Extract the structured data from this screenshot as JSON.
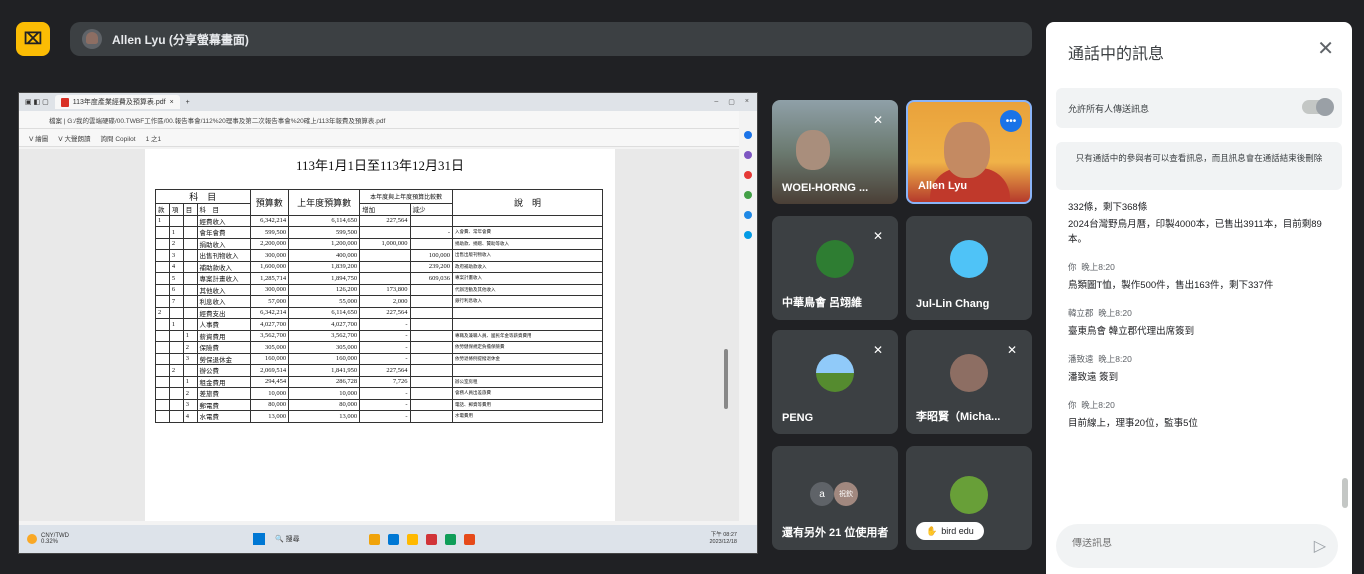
{
  "presenter": {
    "label": "Allen Lyu (分享螢幕畫面)"
  },
  "screen": {
    "tab_title": "113年度產業經費及預算表.pdf",
    "address": "檔案 | G:/我的雲端硬碟/00.TWBF工作區/00.報告事會/112%20理事及第二次報告事會%20確上/113年報費及預算表.pdf",
    "toolbar_items": [
      "Ⅴ 繪圖",
      "Ⅴ 大聲朗讀",
      "詢問 Copilot",
      "1 之1"
    ],
    "doc_title": "113年1月1日至113年12月31日",
    "table": {
      "headers": {
        "subject": "科　目",
        "budget": "預算數",
        "prev": "上年度預算數",
        "compare": "本年度與上年度預算比較數",
        "inc": "增加",
        "dec": "減少",
        "note": "說　明"
      },
      "sub_headers": [
        "款",
        "項",
        "目",
        "科　目"
      ],
      "rows": [
        {
          "k": "1",
          "x": "",
          "m": "",
          "name": "經費收入",
          "budget": "6,342,214",
          "prev": "6,114,650",
          "inc": "227,564",
          "dec": "",
          "note": "",
          "bold": true
        },
        {
          "k": "",
          "x": "1",
          "m": "",
          "name": "會年會費",
          "budget": "599,500",
          "prev": "599,500",
          "inc": "",
          "dec": "-",
          "note": "入會費、常年會費"
        },
        {
          "k": "",
          "x": "2",
          "m": "",
          "name": "捐助收入",
          "budget": "2,200,000",
          "prev": "1,200,000",
          "inc": "1,000,000",
          "dec": "",
          "note": "捐助款、捐贈、贊助等收入"
        },
        {
          "k": "",
          "x": "3",
          "m": "",
          "name": "出售刊物收入",
          "budget": "300,000",
          "prev": "400,000",
          "inc": "",
          "dec": "100,000",
          "note": "出售出版刊物收入"
        },
        {
          "k": "",
          "x": "4",
          "m": "",
          "name": "補助款收入",
          "budget": "1,600,000",
          "prev": "1,839,200",
          "inc": "",
          "dec": "239,200",
          "note": "政府補助款收入"
        },
        {
          "k": "",
          "x": "5",
          "m": "",
          "name": "專案計畫收入",
          "budget": "1,285,714",
          "prev": "1,894,750",
          "inc": "",
          "dec": "609,036",
          "note": "專案計畫收入"
        },
        {
          "k": "",
          "x": "6",
          "m": "",
          "name": "其他收入",
          "budget": "300,000",
          "prev": "126,200",
          "inc": "173,800",
          "dec": "",
          "note": "代辦活動及其他收入"
        },
        {
          "k": "",
          "x": "7",
          "m": "",
          "name": "利息收入",
          "budget": "57,000",
          "prev": "55,000",
          "inc": "2,000",
          "dec": "",
          "note": "銀行利息收入"
        },
        {
          "k": "2",
          "x": "",
          "m": "",
          "name": "經費支出",
          "budget": "6,342,214",
          "prev": "6,114,650",
          "inc": "227,564",
          "dec": "",
          "note": "",
          "bold": true
        },
        {
          "k": "",
          "x": "1",
          "m": "",
          "name": "人事費",
          "budget": "4,027,700",
          "prev": "4,027,700",
          "inc": "-",
          "dec": "",
          "note": "",
          "bold": true
        },
        {
          "k": "",
          "x": "",
          "m": "1",
          "name": "薪資費用",
          "budget": "3,562,700",
          "prev": "3,562,700",
          "inc": "-",
          "dec": "",
          "note": "專職及兼職人員、國民年金等薪資費用"
        },
        {
          "k": "",
          "x": "",
          "m": "2",
          "name": "保險費",
          "budget": "305,000",
          "prev": "305,000",
          "inc": "-",
          "dec": "",
          "note": "依勞健保規定負擔保險費"
        },
        {
          "k": "",
          "x": "",
          "m": "3",
          "name": "勞保退休金",
          "budget": "160,000",
          "prev": "160,000",
          "inc": "-",
          "dec": "",
          "note": "依勞退條例提撥退休金"
        },
        {
          "k": "",
          "x": "2",
          "m": "",
          "name": "辦公費",
          "budget": "2,069,514",
          "prev": "1,841,950",
          "inc": "227,564",
          "dec": "",
          "note": "",
          "bold": true
        },
        {
          "k": "",
          "x": "",
          "m": "1",
          "name": "租金費用",
          "budget": "294,454",
          "prev": "286,728",
          "inc": "7,726",
          "dec": "",
          "note": "辦公室房租"
        },
        {
          "k": "",
          "x": "",
          "m": "2",
          "name": "差旅費",
          "budget": "10,000",
          "prev": "10,000",
          "inc": "-",
          "dec": "",
          "note": "會務人員出差旅費"
        },
        {
          "k": "",
          "x": "",
          "m": "3",
          "name": "郵電費",
          "budget": "80,000",
          "prev": "80,000",
          "inc": "-",
          "dec": "",
          "note": "電話、郵資等費用"
        },
        {
          "k": "",
          "x": "",
          "m": "4",
          "name": "水電費",
          "budget": "13,000",
          "prev": "13,000",
          "inc": "-",
          "dec": "",
          "note": "水電費用"
        }
      ]
    },
    "taskbar": {
      "weather": "CNY/TWD",
      "weather_sub": "0.32%",
      "search": "搜尋",
      "time": "下午 08:27",
      "date": "2023/12/18"
    }
  },
  "participants": [
    {
      "name": "WOEI-HORNG ...",
      "muted": true
    },
    {
      "name": "Allen Lyu",
      "muted": false
    },
    {
      "name": "中華鳥會 呂翊維",
      "muted": true
    },
    {
      "name": "Jul-Lin Chang",
      "muted": false
    },
    {
      "name": "PENG",
      "muted": true
    },
    {
      "name": "李昭賢（Micha...",
      "muted": true
    },
    {
      "name": "還有另外 21 位使用者",
      "initial": "a",
      "initial2": "祝欽"
    },
    {
      "name": "bird edu"
    }
  ],
  "chat": {
    "title": "通話中的訊息",
    "allow_label": "允許所有人傳送訊息",
    "note": "只有通話中的參與者可以查看訊息，而且訊息會在通話結束後刪除",
    "messages": [
      {
        "sender": "",
        "time": "",
        "lines": [
          "332條，剩下368條",
          "2024台灣野鳥月曆，印製4000本，已售出3911本，目前剩89本。"
        ]
      },
      {
        "sender": "你",
        "time": "晚上8:20",
        "lines": [
          "鳥類圖T恤，製作500件，售出163件，剩下337件"
        ]
      },
      {
        "sender": "韓立郡",
        "time": "晚上8:20",
        "lines": [
          "臺東鳥會 韓立郡代理出席簽到"
        ]
      },
      {
        "sender": "潘致遠",
        "time": "晚上8:20",
        "lines": [
          "潘致遠 簽到"
        ]
      },
      {
        "sender": "你",
        "time": "晚上8:20",
        "lines": [
          "目前線上，理事20位，監事5位"
        ]
      }
    ],
    "input_placeholder": "傳送訊息"
  }
}
